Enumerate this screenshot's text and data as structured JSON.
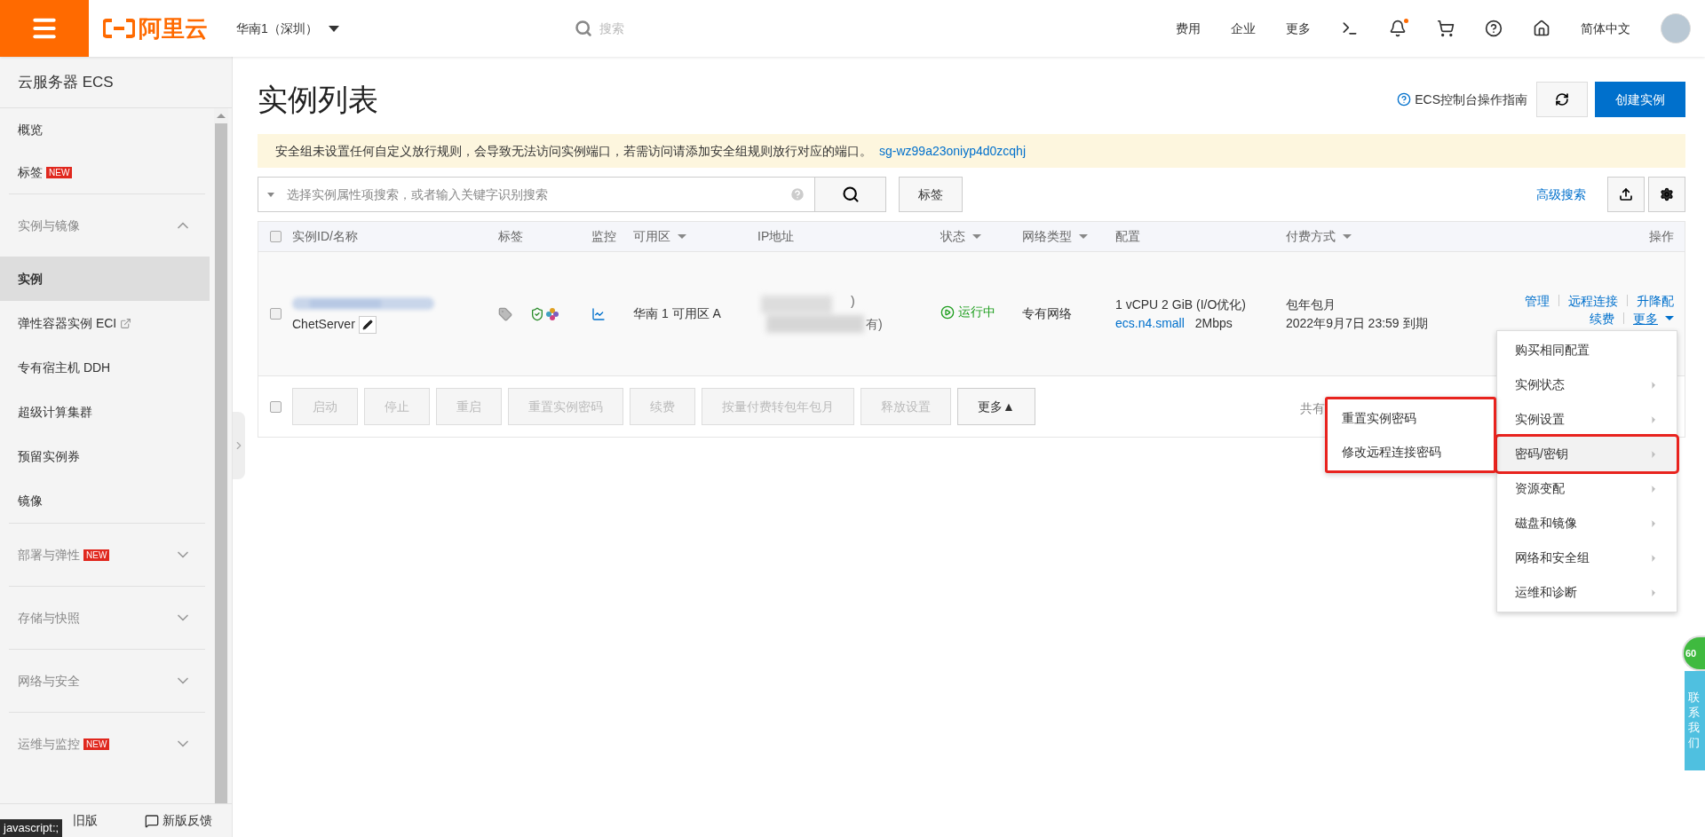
{
  "header": {
    "logo": "阿里云",
    "region": "华南1（深圳）",
    "search_placeholder": "搜索",
    "links": [
      "费用",
      "企业",
      "更多"
    ],
    "notification_dot": true,
    "language": "简体中文"
  },
  "sidebar": {
    "title": "云服务器 ECS",
    "top_items": [
      {
        "label": "概览"
      },
      {
        "label": "标签",
        "badge": "NEW"
      }
    ],
    "sections": [
      {
        "label": "实例与镜像",
        "expanded": true,
        "items": [
          {
            "label": "实例",
            "selected": true,
            "external": false
          },
          {
            "label": "弹性容器实例 ECI",
            "selected": false,
            "external": true
          },
          {
            "label": "专有宿主机 DDH",
            "selected": false,
            "external": false
          },
          {
            "label": "超级计算集群",
            "selected": false,
            "external": false
          },
          {
            "label": "预留实例券",
            "selected": false,
            "external": false
          },
          {
            "label": "镜像",
            "selected": false,
            "external": false
          }
        ]
      },
      {
        "label": "部署与弹性",
        "badge": "NEW",
        "expanded": false
      },
      {
        "label": "存储与快照",
        "expanded": false
      },
      {
        "label": "网络与安全",
        "expanded": false
      },
      {
        "label": "运维与监控",
        "badge": "NEW",
        "expanded": false
      }
    ],
    "footer": {
      "left": "旧版",
      "right": "新版反馈"
    }
  },
  "page": {
    "title": "实例列表",
    "guide_link": "ECS控制台操作指南",
    "create_button": "创建实例",
    "notice": {
      "text": "安全组未设置任何自定义放行规则，会导致无法访问实例端口，若需访问请添加安全组规则放行对应的端口。",
      "link": "sg-wz99a23oniyp4d0zcqhj"
    },
    "search": {
      "placeholder": "选择实例属性项搜索，或者输入关键字识别搜索",
      "tag_button": "标签",
      "advanced_link": "高级搜索"
    }
  },
  "table": {
    "columns": [
      {
        "label": "实例ID/名称",
        "sortable": false
      },
      {
        "label": "标签",
        "sortable": false
      },
      {
        "label": "监控",
        "sortable": false
      },
      {
        "label": "可用区",
        "sortable": true
      },
      {
        "label": "IP地址",
        "sortable": false
      },
      {
        "label": "状态",
        "sortable": true
      },
      {
        "label": "网络类型",
        "sortable": true
      },
      {
        "label": "配置",
        "sortable": false
      },
      {
        "label": "付费方式",
        "sortable": true
      },
      {
        "label": "操作",
        "sortable": false
      }
    ],
    "rows": [
      {
        "checked": false,
        "name": "ChetServer",
        "zone": "华南 1 可用区 A",
        "ip_fragments": [
          ")",
          "有)"
        ],
        "status": "运行中",
        "network": "专有网络",
        "config": "1 vCPU 2 GiB (I/O优化)",
        "instance_type": "ecs.n4.small",
        "bandwidth": "2Mbps",
        "billing": "包年包月",
        "expiry": "2022年9月7日 23:59 到期",
        "actions": [
          "管理",
          "远程连接",
          "升降配",
          "续费"
        ],
        "more": "更多"
      }
    ],
    "bulk_checked": false,
    "bulk_buttons": [
      {
        "label": "启动",
        "disabled": true
      },
      {
        "label": "停止",
        "disabled": true
      },
      {
        "label": "重启",
        "disabled": true
      },
      {
        "label": "重置实例密码",
        "disabled": true
      },
      {
        "label": "续费",
        "disabled": true
      },
      {
        "label": "按量付费转包年包月",
        "disabled": true
      },
      {
        "label": "释放设置",
        "disabled": true
      },
      {
        "label": "更多▲",
        "disabled": false
      }
    ],
    "pagination_text": "共有"
  },
  "more_menu": {
    "items": [
      {
        "label": "购买相同配置",
        "submenu": false,
        "highlighted": false
      },
      {
        "label": "实例状态",
        "submenu": true,
        "highlighted": false
      },
      {
        "label": "实例设置",
        "submenu": true,
        "highlighted": false
      },
      {
        "label": "密码/密钥",
        "submenu": true,
        "highlighted": true
      },
      {
        "label": "资源变配",
        "submenu": true,
        "highlighted": false
      },
      {
        "label": "磁盘和镜像",
        "submenu": true,
        "highlighted": false
      },
      {
        "label": "网络和安全组",
        "submenu": true,
        "highlighted": false
      },
      {
        "label": "运维和诊断",
        "submenu": true,
        "highlighted": false
      }
    ],
    "submenu": {
      "highlighted": true,
      "items": [
        "重置实例密码",
        "修改远程连接密码"
      ]
    }
  },
  "float_widget": {
    "badge": "60",
    "label": "联系我们"
  },
  "status_tooltip": "javascript:;"
}
